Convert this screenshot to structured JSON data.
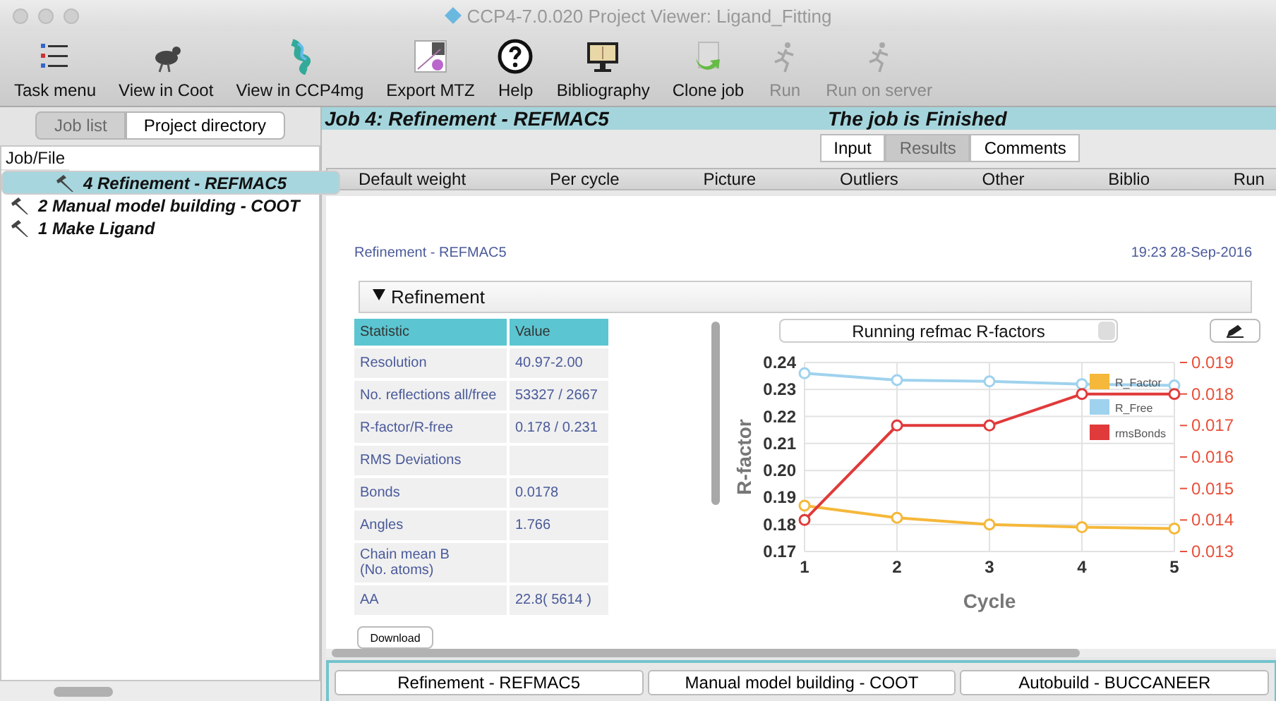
{
  "window": {
    "title": "CCP4-7.0.020 Project Viewer: Ligand_Fitting"
  },
  "toolbar": [
    {
      "label": "Task menu",
      "disabled": false
    },
    {
      "label": "View in Coot",
      "disabled": false
    },
    {
      "label": "View in CCP4mg",
      "disabled": false
    },
    {
      "label": "Export MTZ",
      "disabled": false
    },
    {
      "label": "Help",
      "disabled": false
    },
    {
      "label": "Bibliography",
      "disabled": false
    },
    {
      "label": "Clone job",
      "disabled": false
    },
    {
      "label": "Run",
      "disabled": true
    },
    {
      "label": "Run on server",
      "disabled": true
    }
  ],
  "sidebar": {
    "tabs": [
      {
        "label": "Job list",
        "selected": false
      },
      {
        "label": "Project directory",
        "selected": true
      }
    ],
    "header": "Job/File",
    "items": [
      {
        "label": "4 Refinement - REFMAC5",
        "selected": true
      },
      {
        "label": "2 Manual model building - COOT",
        "selected": false
      },
      {
        "label": "1 Make Ligand",
        "selected": false
      }
    ]
  },
  "job": {
    "title": "Job 4:  Refinement - REFMAC5",
    "status": "The job is Finished",
    "tabs": [
      {
        "label": "Input",
        "disabled": false
      },
      {
        "label": "Results",
        "disabled": true
      },
      {
        "label": "Comments",
        "disabled": false
      }
    ],
    "subtabs": [
      "Default weight",
      "Per cycle",
      "Picture",
      "Outliers",
      "Other",
      "Biblio",
      "Run"
    ],
    "report": {
      "title": "Refinement - REFMAC5",
      "time": "19:23 28-Sep-2016",
      "section": "Refinement",
      "expanded": true,
      "table": {
        "columns": [
          "Statistic",
          "Value"
        ],
        "rows": [
          {
            "label": "Resolution",
            "value": "40.97-2.00"
          },
          {
            "label": "No. reflections all/free",
            "value": "53327 / 2667"
          },
          {
            "label": "R-factor/R-free",
            "value": "0.178 / 0.231"
          },
          {
            "label": "RMS Deviations"
          },
          {
            "label": "Bonds",
            "value": "0.0178"
          },
          {
            "label": "Angles",
            "value": "1.766"
          },
          {
            "label": "Chain mean B (No. atoms)"
          },
          {
            "label": "AA",
            "value": "22.8( 5614 )"
          }
        ]
      },
      "download": "Download",
      "graph_select": "Running refmac R-factors",
      "chart_data": {
        "type": "line",
        "xlabel": "Cycle",
        "ylabel": "R-factor",
        "grid": true,
        "legend": "upper right",
        "x": [
          1,
          2,
          3,
          4,
          5
        ],
        "xlim": [
          1,
          5
        ],
        "ylim": [
          0.17,
          0.24
        ],
        "yticks": [
          {
            "value": 0.17,
            "label": "0.17"
          },
          {
            "value": 0.18,
            "label": "0.18"
          },
          {
            "value": 0.19,
            "label": "0.19"
          },
          {
            "value": 0.2,
            "label": "0.20"
          },
          {
            "value": 0.21,
            "label": "0.21"
          },
          {
            "value": 0.22,
            "label": "0.22"
          },
          {
            "value": 0.23,
            "label": "0.23"
          },
          {
            "value": 0.24,
            "label": "0.24"
          }
        ],
        "xticks": [
          1,
          2,
          3,
          4,
          5
        ],
        "y2lim": [
          0.013,
          0.019
        ],
        "y2ticks": [
          {
            "value": 0.013,
            "label": "0.013"
          },
          {
            "value": 0.014,
            "label": "0.014"
          },
          {
            "value": 0.015,
            "label": "0.015"
          },
          {
            "value": 0.016,
            "label": "0.016"
          },
          {
            "value": 0.017,
            "label": "0.017"
          },
          {
            "value": 0.018,
            "label": "0.018"
          },
          {
            "value": 0.019,
            "label": "0.019"
          }
        ],
        "series": [
          {
            "name": "R_Factor",
            "color": "#f5b83a",
            "marker": "circle",
            "values": [
              0.187,
              0.1825,
              0.18,
              0.179,
              0.1785
            ]
          },
          {
            "name": "R_Free",
            "color": "#9fd2ee",
            "marker": "circle",
            "values": [
              0.236,
              0.2335,
              0.233,
              0.232,
              0.2315
            ]
          },
          {
            "name": "rmsBonds",
            "color": "#e03a3a",
            "axis": "y2",
            "marker": "circle",
            "values": [
              0.014,
              0.017,
              0.017,
              0.018,
              0.018
            ]
          }
        ]
      }
    }
  },
  "job_buttons": [
    "Refinement - REFMAC5",
    "Manual model building - COOT",
    "Autobuild - BUCCANEER"
  ]
}
